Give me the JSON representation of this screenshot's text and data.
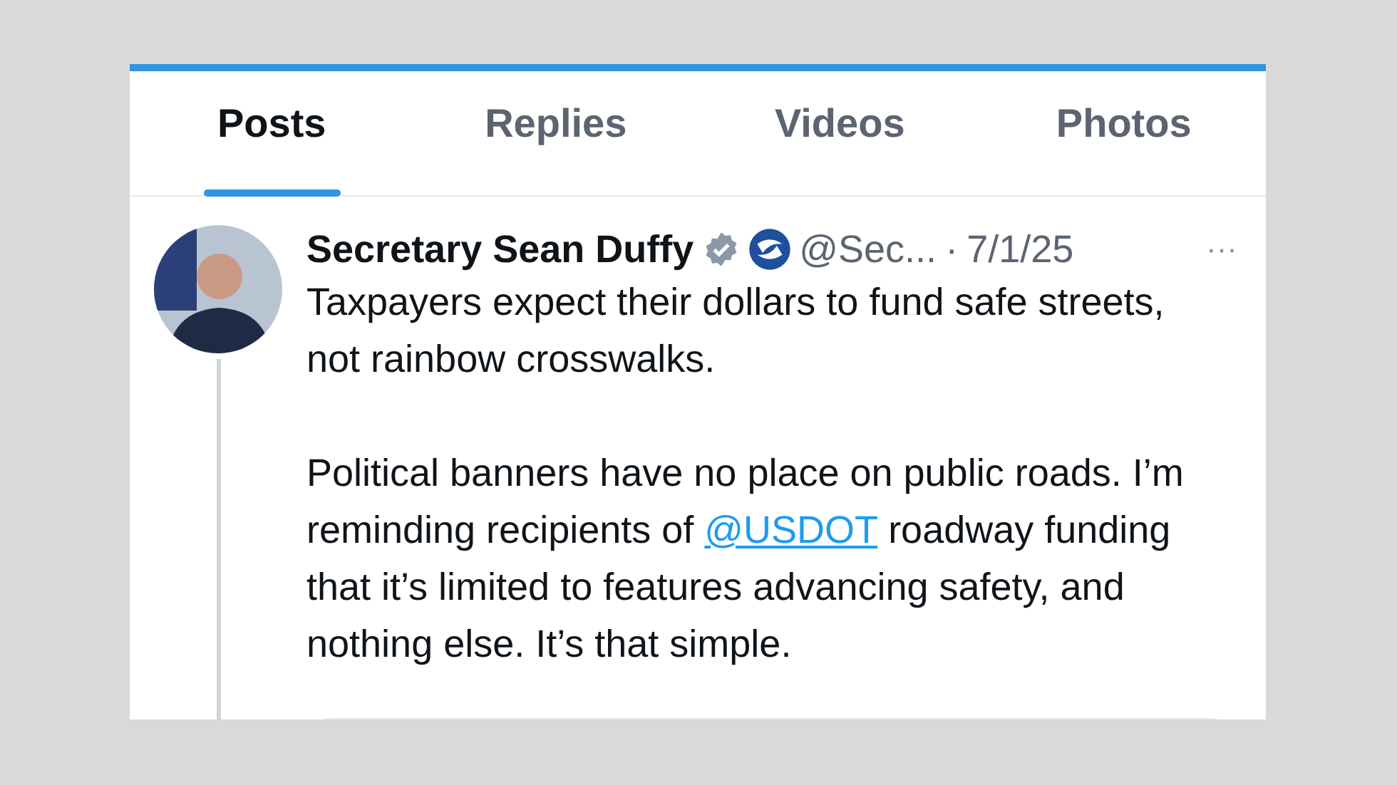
{
  "tabs": [
    {
      "label": "Posts",
      "selected": true
    },
    {
      "label": "Replies",
      "selected": false
    },
    {
      "label": "Videos",
      "selected": false
    },
    {
      "label": "Photos",
      "selected": false
    }
  ],
  "post": {
    "author": "Secretary Sean Duffy",
    "verified": true,
    "handle": "@Sec...",
    "separator": "·",
    "date": "7/1/25",
    "more": "···",
    "paragraphs": [
      [
        {
          "kind": "text",
          "text": "Taxpayers expect their dollars to fund safe streets, not rainbow crosswalks."
        }
      ],
      [
        {
          "kind": "text",
          "text": "Political banners have no place on public roads. I’m reminding recipients of "
        },
        {
          "kind": "mention",
          "text": "@USDOT"
        },
        {
          "kind": "text",
          "text": " roadway funding that it’s limited to features advancing safety, and nothing else. It’s that simple."
        }
      ]
    ]
  }
}
